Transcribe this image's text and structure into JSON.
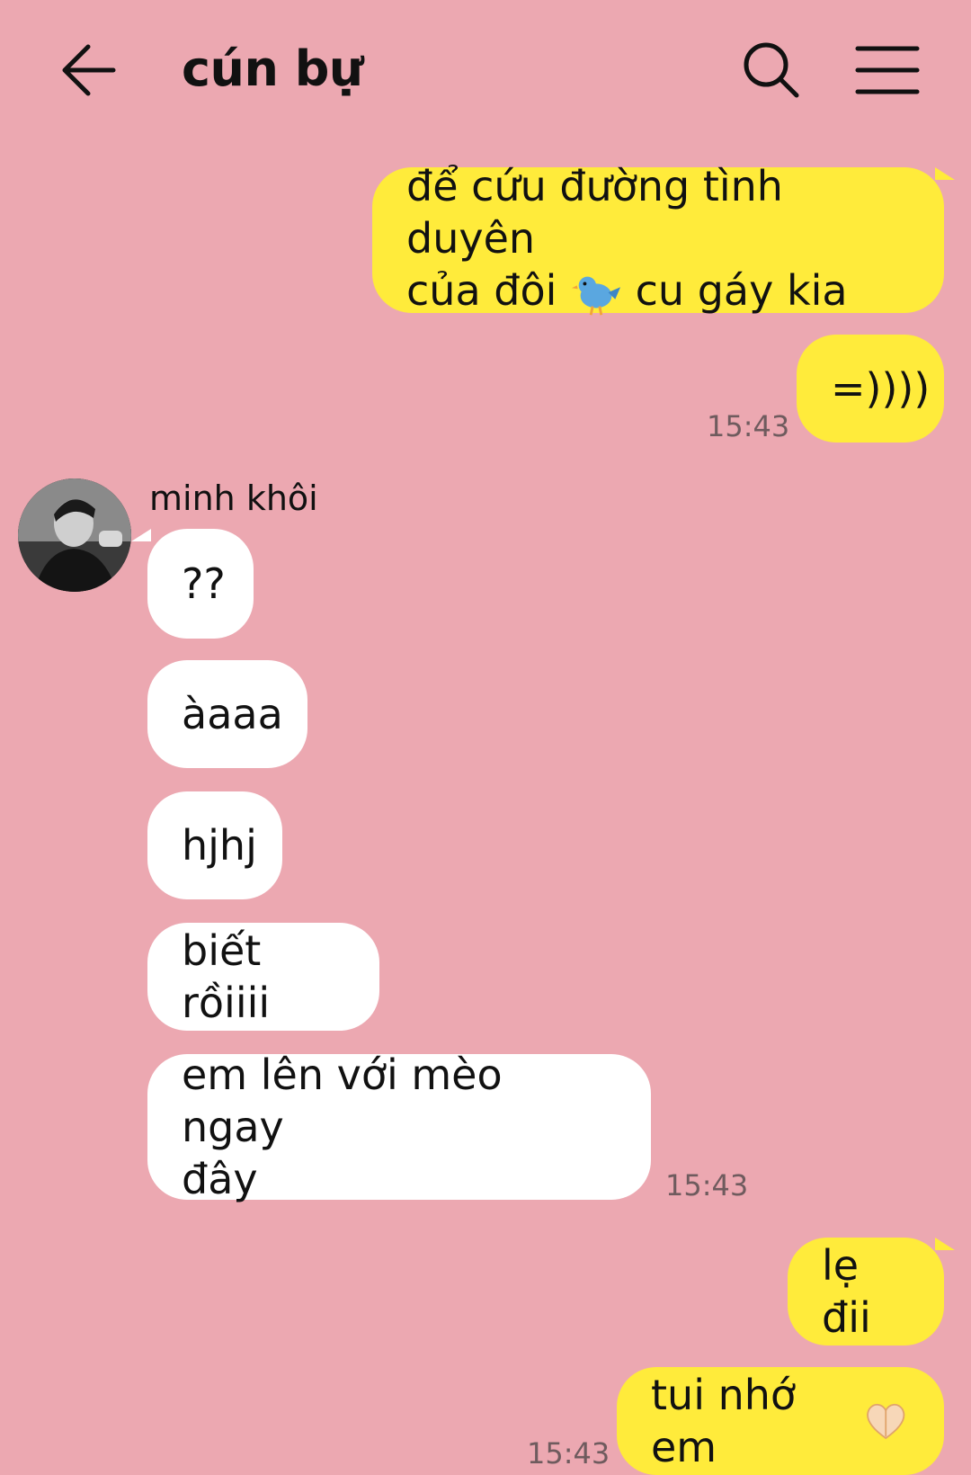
{
  "header": {
    "title": "cún bự",
    "back_icon": "arrow-left-icon",
    "search_icon": "search-icon",
    "menu_icon": "hamburger-menu-icon"
  },
  "colors": {
    "background": "#eca8b1",
    "outgoing_bubble": "#ffeb3b",
    "incoming_bubble": "#ffffff",
    "timestamp": "#6f5b5e"
  },
  "messages": {
    "m1": {
      "line1": "để cứu đường tình duyên",
      "line2_a": "của đôi",
      "line2_emoji": "bird-emoji",
      "line2_b": "cu gáy kia"
    },
    "m2": {
      "text": "=))))",
      "time": "15:43"
    },
    "sender_name": "minh khôi",
    "m3": {
      "text": "??"
    },
    "m4": {
      "text": "àaaa"
    },
    "m5": {
      "text": "hjhj"
    },
    "m6": {
      "text": "biết rồiiii"
    },
    "m7": {
      "line1": "em lên với mèo ngay",
      "line2": "đây",
      "time": "15:43"
    },
    "m8": {
      "text": "lẹ đii"
    },
    "m9": {
      "text": "tui nhớ em",
      "emoji": "heart-hands-emoji",
      "time": "15:43"
    }
  }
}
